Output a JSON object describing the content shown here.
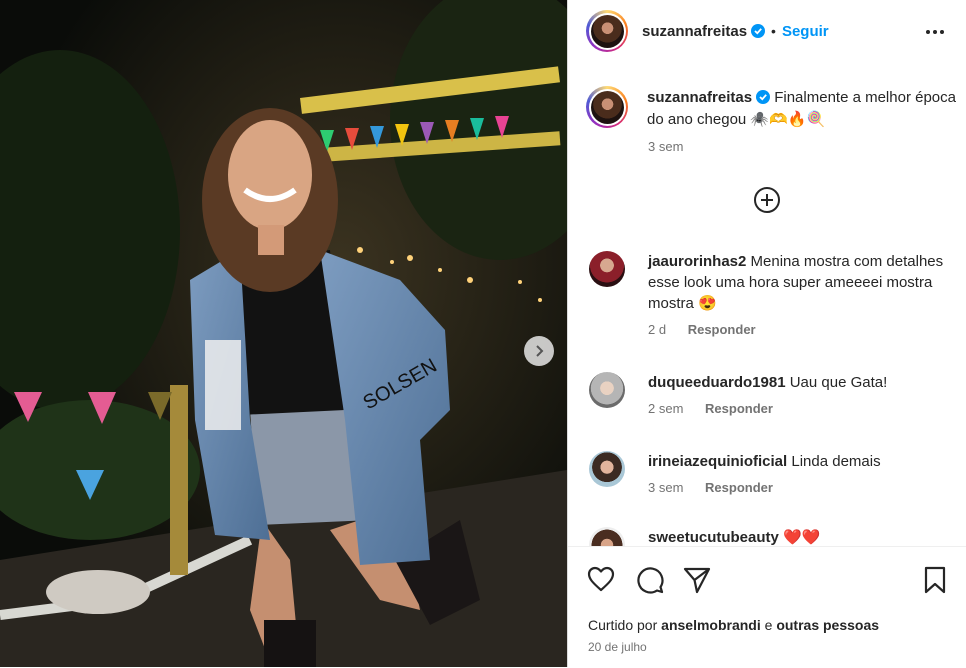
{
  "post": {
    "photo_alt": "photo",
    "next_icon": "chevron-right-icon"
  },
  "header": {
    "username": "suzannafreitas",
    "separator": "•",
    "follow_label": "Seguir",
    "more_icon": "more-horizontal-icon"
  },
  "caption": {
    "username": "suzannafreitas",
    "text": "Finalmente a melhor época do ano chegou 🕷️🫶🔥🍭",
    "time": "3 sem"
  },
  "load_more_icon": "plus-circle-icon",
  "comments": [
    {
      "username": "jaaurorinhas2",
      "text": "Menina mostra com detalhes esse look uma hora super ameeeei mostra mostra 😍",
      "time": "2 d",
      "reply": "Responder"
    },
    {
      "username": "duqueeduardo1981",
      "text": "Uau que Gata!",
      "time": "2 sem",
      "reply": "Responder"
    },
    {
      "username": "irineiazequinioficial",
      "text": "Linda demais",
      "time": "3 sem",
      "reply": "Responder"
    },
    {
      "username": "sweetucutubeauty",
      "text": "❤️❤️",
      "time": "",
      "reply": ""
    }
  ],
  "actions": {
    "like_icon": "heart-icon",
    "comment_icon": "comment-icon",
    "share_icon": "share-icon",
    "save_icon": "bookmark-icon"
  },
  "likes": {
    "prefix": "Curtido por",
    "user": "anselmobrandi",
    "joiner": "e",
    "others": "outras pessoas"
  },
  "date": "20 de julho",
  "colors": {
    "accent": "#0095f6",
    "text": "#262626",
    "muted": "#737373",
    "heart": "#ed4956"
  }
}
